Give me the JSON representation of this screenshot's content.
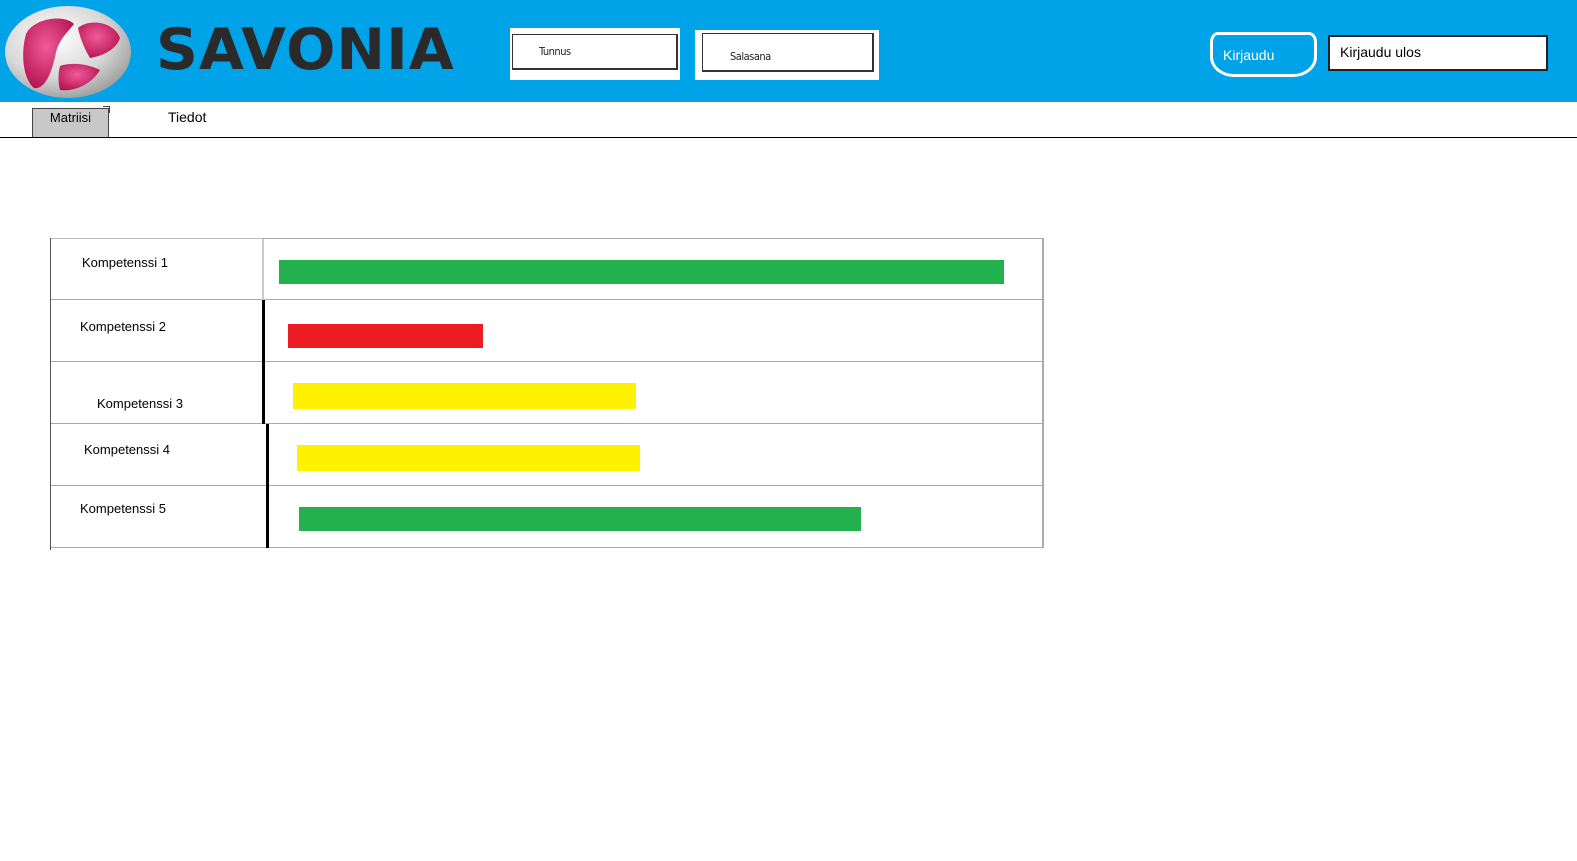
{
  "brand": {
    "name": "SAVONIA"
  },
  "login": {
    "username_placeholder": "Tunnus",
    "password_placeholder": "Salasana",
    "login_label": "Kirjaudu",
    "logout_label": "Kirjaudu ulos"
  },
  "tabs": [
    {
      "label": "Matriisi",
      "active": true
    },
    {
      "label": "Tiedot",
      "active": false
    }
  ],
  "colors": {
    "header": "#00a2e8",
    "green": "#22b14c",
    "red": "#ed1c24",
    "yellow": "#fff200"
  },
  "competences": [
    {
      "label": "Kompetenssi 1",
      "level": 0.93,
      "color": "green"
    },
    {
      "label": "Kompetenssi 2",
      "level": 0.25,
      "color": "red"
    },
    {
      "label": "Kompetenssi 3",
      "level": 0.44,
      "color": "yellow"
    },
    {
      "label": "Kompetenssi 4",
      "level": 0.44,
      "color": "yellow"
    },
    {
      "label": "Kompetenssi 5",
      "level": 0.72,
      "color": "green"
    }
  ]
}
